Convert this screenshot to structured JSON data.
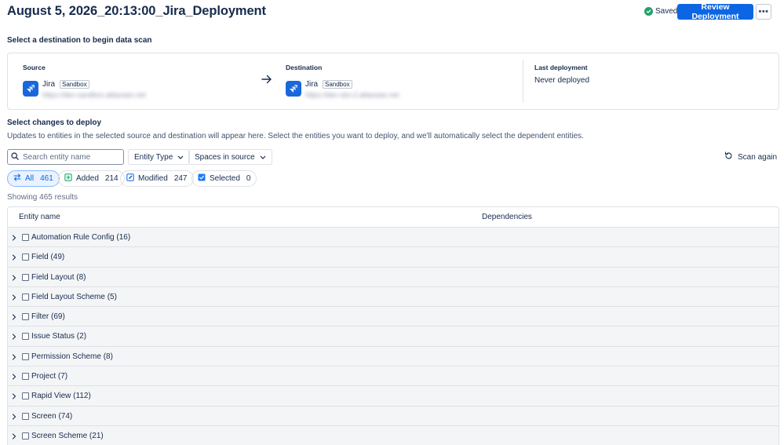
{
  "header": {
    "title": "August 5, 2026_20:13:00_Jira_Deployment",
    "saved_label": "Saved",
    "review_button": "Review Deployment",
    "more_label": "•••"
  },
  "destination_prompt": "Select a destination to begin data scan",
  "card": {
    "source": {
      "label": "Source",
      "app": "Jira",
      "env": "Sandbox",
      "url": "https://dev-sandbox.atlassian.net"
    },
    "destination": {
      "label": "Destination",
      "app": "Jira",
      "env": "Sandbox",
      "url": "https://dev-sbx-2.atlassian.net"
    },
    "last_deployment": {
      "label": "Last deployment",
      "value": "Never deployed"
    }
  },
  "changes": {
    "title": "Select changes to deploy",
    "description": "Updates to entities in the selected source and destination will appear here. Select the entities you want to deploy, and we'll automatically select the dependent entities."
  },
  "filters": {
    "search_placeholder": "Search entity name",
    "entity_type": "Entity Type",
    "spaces": "Spaces in source",
    "scan_again": "Scan again"
  },
  "pills": {
    "all": {
      "label": "All",
      "count": "461"
    },
    "added": {
      "label": "Added",
      "count": "214"
    },
    "modified": {
      "label": "Modified",
      "count": "247"
    },
    "selected": {
      "label": "Selected",
      "count": "0"
    }
  },
  "results_text": "Showing 465 results",
  "table": {
    "col_entity": "Entity name",
    "col_deps": "Dependencies",
    "rows": [
      "Automation Rule Config (16)",
      "Field (49)",
      "Field Layout (8)",
      "Field Layout Scheme (5)",
      "Filter (69)",
      "Issue Status (2)",
      "Permission Scheme (8)",
      "Project (7)",
      "Rapid View (112)",
      "Screen (74)",
      "Screen Scheme (21)"
    ]
  },
  "colors": {
    "primary": "#0c66e4",
    "saved_green": "#22a06b",
    "jira_blue": "#1868db",
    "row_bg": "#f4f5f7"
  }
}
